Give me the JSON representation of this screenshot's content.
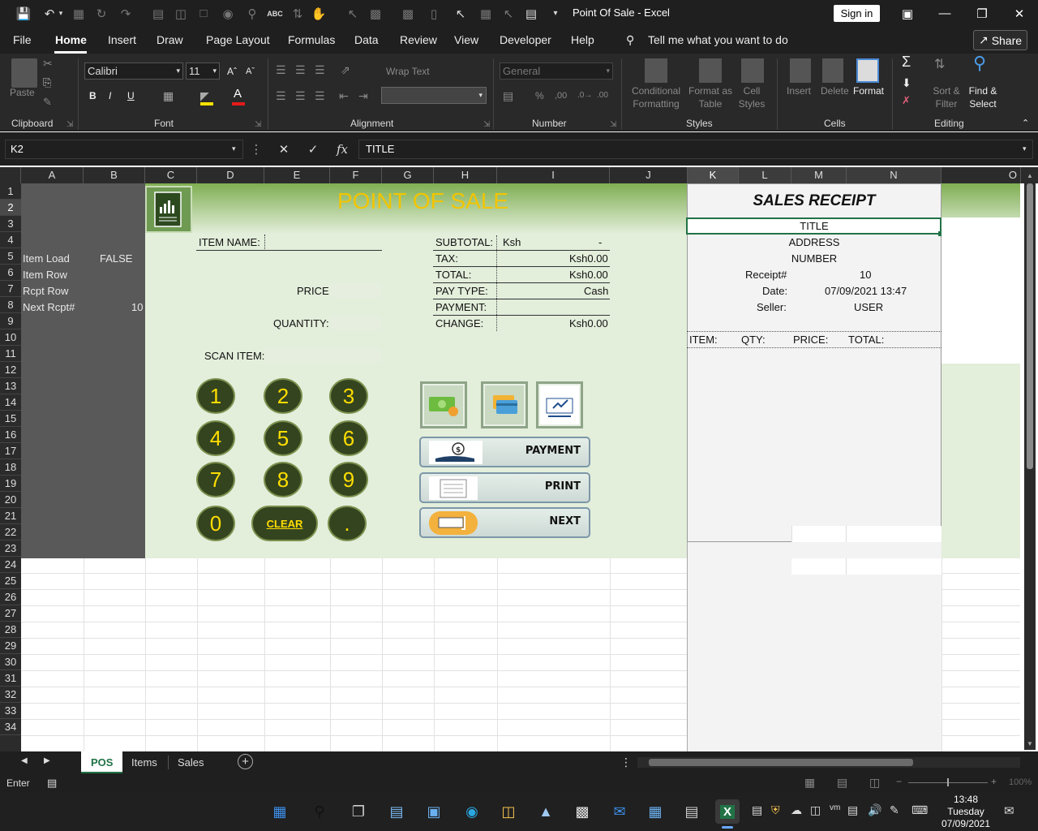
{
  "window": {
    "title": "Point Of Sale  -  Excel",
    "sign_in": "Sign in"
  },
  "menu": {
    "tabs": [
      "File",
      "Home",
      "Insert",
      "Draw",
      "Page Layout",
      "Formulas",
      "Data",
      "Review",
      "View",
      "Developer",
      "Help"
    ],
    "active": "Home",
    "tell_me": "Tell me what you want to do",
    "share": "Share"
  },
  "ribbon": {
    "clipboard": {
      "label": "Clipboard",
      "paste": "Paste"
    },
    "font": {
      "label": "Font",
      "name": "Calibri",
      "size": "11"
    },
    "alignment": {
      "label": "Alignment",
      "wrap": "Wrap Text"
    },
    "number": {
      "label": "Number",
      "format": "General"
    },
    "styles": {
      "label": "Styles",
      "conditional": "Conditional Formatting",
      "format_table": "Format as Table",
      "cell_styles": "Cell Styles"
    },
    "cells": {
      "label": "Cells",
      "insert": "Insert",
      "delete": "Delete",
      "format": "Format"
    },
    "editing": {
      "label": "Editing",
      "sort": "Sort & Filter",
      "find": "Find & Select"
    }
  },
  "formula_bar": {
    "name_box": "K2",
    "content": "TITLE"
  },
  "columns": [
    "A",
    "B",
    "C",
    "D",
    "E",
    "F",
    "G",
    "H",
    "I",
    "J",
    "K",
    "L",
    "M",
    "N",
    "O"
  ],
  "selected_column": "K",
  "rows": [
    "1",
    "2",
    "3",
    "4",
    "5",
    "6",
    "7",
    "8",
    "9",
    "10",
    "11",
    "12",
    "13",
    "14",
    "15",
    "16",
    "17",
    "18",
    "19",
    "20",
    "21",
    "22",
    "23",
    "24",
    "25",
    "26",
    "27",
    "28",
    "29",
    "30",
    "31",
    "32",
    "33",
    "34"
  ],
  "selected_row": "2",
  "side": {
    "item_load_label": "Item Load",
    "item_load_value": "FALSE",
    "item_row": "Item Row",
    "rcpt_row": "Rcpt Row",
    "next_rcpt_label": "Next Rcpt#",
    "next_rcpt_value": "10"
  },
  "pos": {
    "title": "POINT OF SALE",
    "item_name": "ITEM NAME:",
    "price": "PRICE:",
    "quantity": "QUANTITY:",
    "scan_item": "SCAN ITEM:",
    "keypad": [
      "1",
      "2",
      "3",
      "4",
      "5",
      "6",
      "7",
      "8",
      "9",
      "0",
      "CLEAR",
      "."
    ],
    "summary": {
      "subtotal_label": "SUBTOTAL:",
      "subtotal_currency": "Ksh",
      "subtotal_value": "-",
      "tax_label": "TAX:",
      "tax_value": "Ksh0.00",
      "total_label": "TOTAL:",
      "total_value": "Ksh0.00",
      "paytype_label": "PAY TYPE:",
      "paytype_value": "Cash",
      "payment_label": "PAYMENT:",
      "change_label": "CHANGE:",
      "change_value": "Ksh0.00"
    },
    "actions": {
      "payment": "PAYMENT",
      "print": "PRINT",
      "next": "NEXT"
    }
  },
  "receipt": {
    "heading": "SALES RECEIPT",
    "title": "TITLE",
    "address": "ADDRESS",
    "number": "NUMBER",
    "receipt_label": "Receipt#",
    "receipt_value": "10",
    "date_label": "Date:",
    "date_value": "07/09/2021 13:47",
    "seller_label": "Seller:",
    "seller_value": "USER",
    "col_item": "ITEM:",
    "col_qty": "QTY:",
    "col_price": "PRICE:",
    "col_total": "TOTAL:"
  },
  "sheets": {
    "tabs": [
      "POS",
      "Items",
      "Sales"
    ],
    "active": "POS"
  },
  "status": {
    "mode": "Enter",
    "zoom": "100%"
  },
  "taskbar": {
    "time": "13:48",
    "day": "Tuesday",
    "date": "07/09/2021"
  },
  "colors": {
    "green_panel": "#e3eedb",
    "header_gradient_top": "#7fae52",
    "title_yellow": "#f2c500",
    "keypad_bg": "#33441f",
    "keypad_digit": "#ffdd00",
    "dark_side_panel": "#595959",
    "accent": "#217346"
  }
}
